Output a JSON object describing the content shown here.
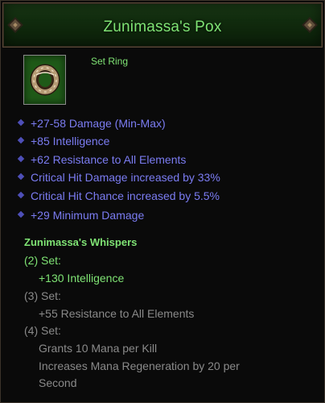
{
  "item": {
    "name": "Zunimassa's Pox",
    "type": "Set Ring",
    "icon": "ring-icon"
  },
  "affixes": [
    "+27-58 Damage (Min-Max)",
    "+85 Intelligence",
    "+62 Resistance to All Elements",
    "Critical Hit Damage increased by 33%",
    "Critical Hit Chance increased by 5.5%",
    "+29 Minimum Damage"
  ],
  "set": {
    "name": "Zunimassa's Whispers",
    "tiers": [
      {
        "label": "(2) Set:",
        "active": true,
        "bonuses": [
          "+130 Intelligence"
        ]
      },
      {
        "label": "(3) Set:",
        "active": false,
        "bonuses": [
          "+55 Resistance to All Elements"
        ]
      },
      {
        "label": "(4) Set:",
        "active": false,
        "bonuses": [
          "Grants 10 Mana per Kill",
          "Increases Mana Regeneration by 20 per",
          "Second"
        ]
      }
    ]
  },
  "colors": {
    "legendary_green": "#7fe374",
    "magic_blue": "#7b7cf2",
    "inactive_gray": "#8a8a8a"
  }
}
